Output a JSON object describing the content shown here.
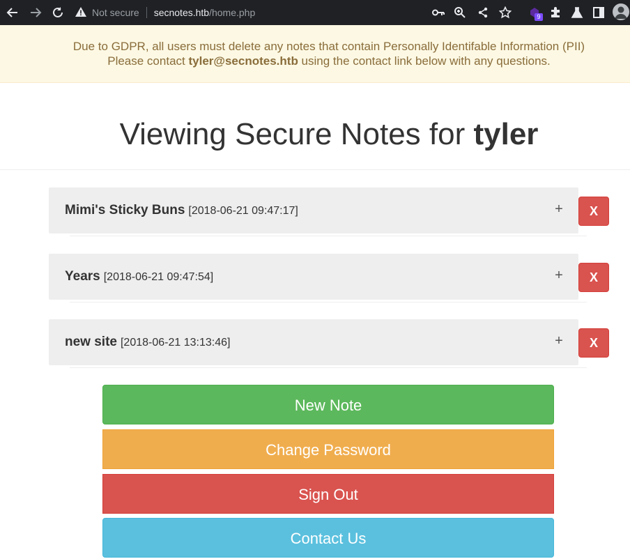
{
  "browser": {
    "not_secure": "Not secure",
    "url_host": "secnotes.htb",
    "url_path": "/home.php",
    "extension_badge": "9"
  },
  "notice": {
    "line1": "Due to GDPR, all users must delete any notes that contain Personally Identifable Information (PII)",
    "line2_pre": "Please contact ",
    "line2_email": "tyler@secnotes.htb",
    "line2_post": " using the contact link below with any questions."
  },
  "title": {
    "prefix": "Viewing Secure Notes for ",
    "user": "tyler"
  },
  "notes": [
    {
      "title": "Mimi's Sticky Buns",
      "date": "[2018-06-21 09:47:17]"
    },
    {
      "title": "Years",
      "date": "[2018-06-21 09:47:54]"
    },
    {
      "title": "new site",
      "date": "[2018-06-21 13:13:46]"
    }
  ],
  "note_expand_label": "+",
  "note_delete_label": "X",
  "actions": {
    "new_note": "New Note",
    "change_password": "Change Password",
    "sign_out": "Sign Out",
    "contact_us": "Contact Us"
  },
  "colors": {
    "success": "#5cb85c",
    "warning": "#f0ad4e",
    "danger": "#d9534f",
    "info": "#5bc0de",
    "notice_bg": "#fcf8e3",
    "notice_text": "#8a6d3b"
  },
  "icons": [
    "back-arrow-icon",
    "forward-arrow-icon",
    "reload-icon",
    "warning-icon",
    "key-icon",
    "zoom-icon",
    "share-icon",
    "star-icon",
    "extension-icon",
    "puzzle-icon",
    "flask-icon",
    "sidebar-icon",
    "avatar-icon"
  ]
}
